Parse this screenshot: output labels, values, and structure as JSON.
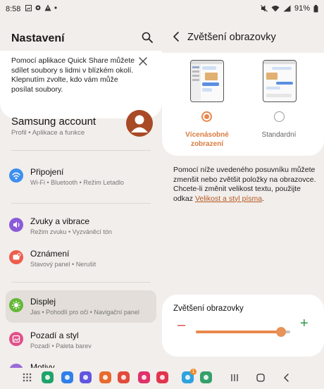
{
  "status_bar": {
    "time": "8:58",
    "battery": "91%"
  },
  "settings": {
    "title": "Nastavení",
    "quick_share": "Pomocí aplikace Quick Share můžete sdílet soubory s lidmi v blízkém okolí. Klepnutím zvolte, kdo vám může posílat soubory.",
    "account": {
      "title": "Samsung account",
      "subtitle": "Profil  •  Aplikace a funkce"
    },
    "items": [
      {
        "title": "Připojení",
        "subtitle": "Wi-Fi  •  Bluetooth  •  Režim Letadlo",
        "color": "#3d8ff0"
      },
      {
        "title": "Zvuky a vibrace",
        "subtitle": "Režim zvuku  •  Vyzváněcí tón",
        "color": "#8b5ad9"
      },
      {
        "title": "Oznámení",
        "subtitle": "Stavový panel  •  Nerušit",
        "color": "#ee5d4d"
      },
      {
        "title": "Displej",
        "subtitle": "Jas  •  Pohodlí pro oči  •  Navigační panel",
        "color": "#63b837"
      },
      {
        "title": "Pozadí a styl",
        "subtitle": "Pozadí  •  Paleta barev",
        "color": "#e0508a"
      },
      {
        "title": "Motivy",
        "subtitle": "",
        "color": "#9a6bd8"
      }
    ]
  },
  "screen_zoom": {
    "title": "Zvětšení obrazovky",
    "modes": [
      {
        "label": "Vícenásobné zobrazení",
        "selected": true
      },
      {
        "label": "Standardní",
        "selected": false
      }
    ],
    "description": "Pomocí níže uvedeného posuvníku můžete zmenšit nebo zvětšit položky na obrazovce. Chcete-li změnit velikost textu, použijte odkaz",
    "description_link": "Velikost a styl písma",
    "description_end": ".",
    "slider_title": "Zvětšení obrazovky",
    "slider_value": 0.9,
    "slider_minus": "–",
    "slider_plus": "+"
  },
  "dock": {
    "apps": [
      {
        "name": "apps-grid-icon",
        "color": "#5a5a5a"
      },
      {
        "name": "calls-app-icon",
        "color": "#1fa36a"
      },
      {
        "name": "messages-app-icon",
        "color": "#2f7fea"
      },
      {
        "name": "internet-app-icon",
        "color": "#5f55e0"
      },
      {
        "name": "store-app-icon",
        "color": "#e86a2e"
      },
      {
        "name": "chrome-app-icon",
        "color": "#e24b3b"
      },
      {
        "name": "flower-app-icon",
        "color": "#e0306a"
      },
      {
        "name": "camera-app-icon",
        "color": "#e2354e"
      },
      {
        "name": "telegram-app-icon",
        "color": "#2ea3e0"
      },
      {
        "name": "gallery-app-icon",
        "color": "#35a06b"
      }
    ],
    "badge": "1"
  }
}
